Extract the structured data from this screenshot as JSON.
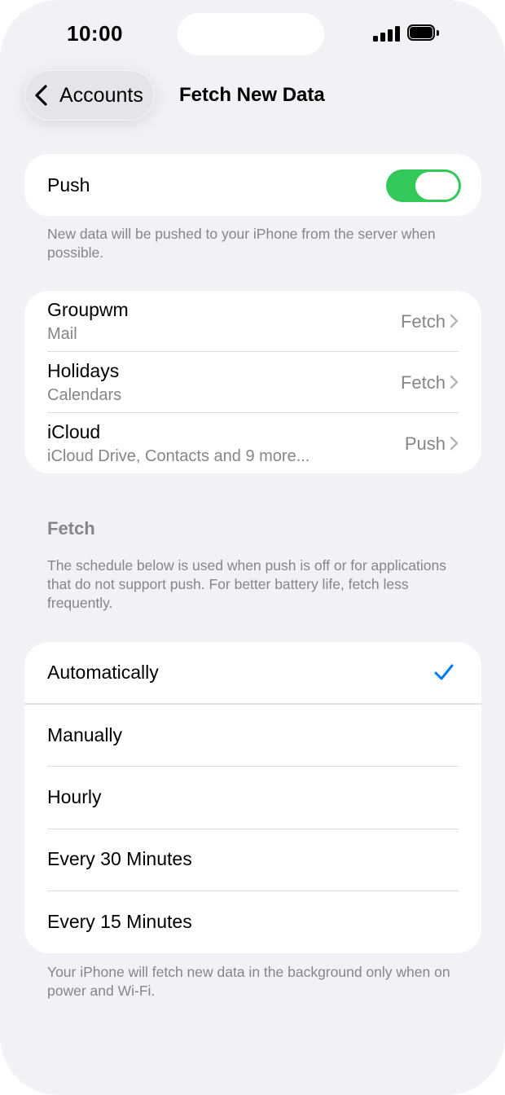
{
  "status_bar": {
    "time": "10:00"
  },
  "nav": {
    "back_label": "Accounts",
    "title": "Fetch New Data"
  },
  "push": {
    "label": "Push",
    "enabled": true,
    "footnote": "New data will be pushed to your iPhone from the server when possible."
  },
  "accounts": [
    {
      "title": "Groupwm",
      "subtitle": "Mail",
      "value": "Fetch"
    },
    {
      "title": "Holidays",
      "subtitle": "Calendars",
      "value": "Fetch"
    },
    {
      "title": "iCloud",
      "subtitle": "iCloud Drive, Contacts and 9 more...",
      "value": "Push"
    }
  ],
  "fetch": {
    "header": "Fetch",
    "description": "The schedule below is used when push is off or for applications that do not support push. For better battery life, fetch less frequently.",
    "options": [
      {
        "label": "Automatically",
        "selected": true
      },
      {
        "label": "Manually",
        "selected": false
      },
      {
        "label": "Hourly",
        "selected": false
      },
      {
        "label": "Every 30 Minutes",
        "selected": false
      },
      {
        "label": "Every 15 Minutes",
        "selected": false
      }
    ],
    "footnote": "Your iPhone will fetch new data in the background only when on power and Wi-Fi."
  },
  "colors": {
    "background": "#f1f1f6",
    "toggle_on": "#34c759",
    "checkmark": "#007aff",
    "secondary_text": "#85858b"
  },
  "icons": {
    "back": "chevron-left-icon",
    "disclosure": "chevron-right-icon",
    "selected": "checkmark-icon"
  }
}
